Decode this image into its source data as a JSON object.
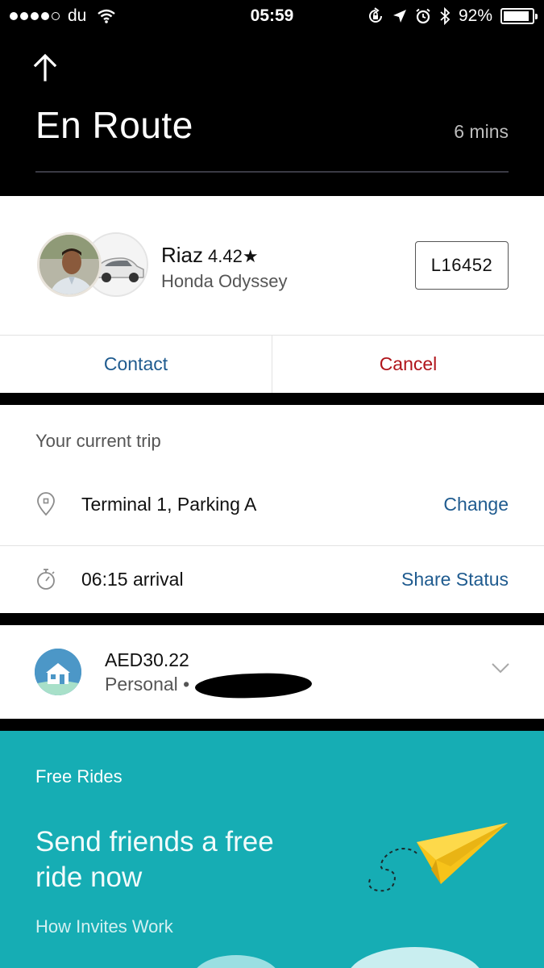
{
  "status_bar": {
    "carrier": "du",
    "time": "05:59",
    "battery": "92%",
    "battery_level": 0.92
  },
  "header": {
    "title": "En Route",
    "eta": "6 mins"
  },
  "driver": {
    "name": "Riaz",
    "rating": "4.42★",
    "vehicle": "Honda Odyssey",
    "plate": "L16452"
  },
  "actions": {
    "contact": "Contact",
    "cancel": "Cancel"
  },
  "trip": {
    "title": "Your current trip",
    "destination": "Terminal 1, Parking A",
    "destination_action": "Change",
    "arrival": "06:15 arrival",
    "arrival_action": "Share Status"
  },
  "payment": {
    "fare": "AED30.22",
    "profile": "Personal •"
  },
  "promo": {
    "label": "Free Rides",
    "headline": "Send friends a free ride now",
    "link": "How Invites Work"
  },
  "colors": {
    "link_blue": "#1f5b8f",
    "cancel_red": "#b0151b",
    "promo_teal": "#16adb4",
    "plane_yellow": "#f7c31a"
  },
  "icons": {
    "back": "arrow-up-icon",
    "destination": "map-pin-icon",
    "arrival": "stopwatch-icon",
    "payment": "home-icon",
    "expand": "chevron-down-icon"
  }
}
